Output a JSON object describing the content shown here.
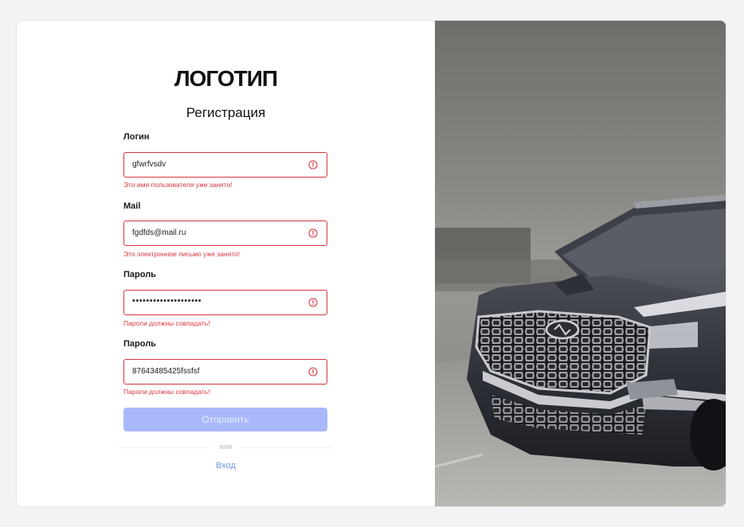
{
  "brand": {
    "logo": "ЛОГОТИП"
  },
  "page": {
    "title": "Регистрация"
  },
  "form": {
    "fields": [
      {
        "label": "Логин",
        "value": "gfwrfvsdv",
        "error": "Это имя пользователя уже занято!",
        "status_icon": "error-circle-icon"
      },
      {
        "label": "Mail",
        "value": "fgdfds@mail.ru",
        "error": "Это электронное письмо уже занято!",
        "status_icon": "error-circle-icon"
      },
      {
        "label": "Пароль",
        "value": "••••••••••••••••••••",
        "error": "Пароли должны совпадать!",
        "status_icon": "error-circle-icon"
      },
      {
        "label": "Пароль",
        "value": "87643485425fssfsf",
        "error": "Пароли должны совпадать!",
        "status_icon": "error-circle-icon"
      }
    ],
    "submit_label": "Отправить",
    "divider_text": "или",
    "login_link": "Вход"
  },
  "colors": {
    "error": "#d9363e",
    "submit_disabled_bg": "#a9b8fb",
    "link": "#6f9be6"
  },
  "hero": {
    "image": "car-photo"
  }
}
